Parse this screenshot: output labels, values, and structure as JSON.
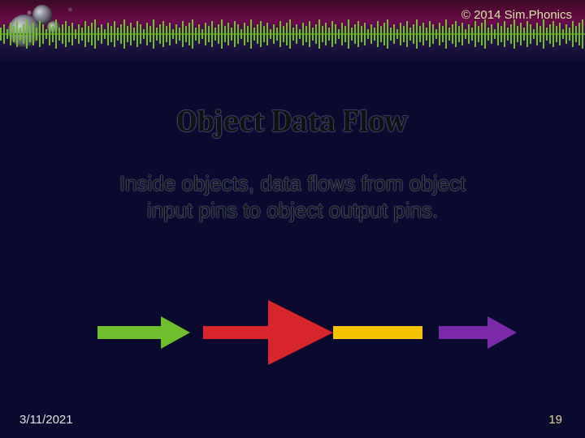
{
  "header": {
    "copyright": "© 2014 Sim.Phonics"
  },
  "slide": {
    "title": "Object Data Flow",
    "body_line1": "Inside objects, data flows from object",
    "body_line2": "input pins to  object output pins."
  },
  "footer": {
    "date": "3/11/2021",
    "page": "19"
  },
  "arrows": {
    "left_color": "#6fbf2d",
    "center_shaft_color": "#d8262c",
    "center_head_color": "#d8262c",
    "connector_color": "#f3c300",
    "right_color": "#7a2aa8"
  },
  "waveform": {
    "color": "#6fbf2d",
    "baseline_color": "#4a8a1a"
  }
}
